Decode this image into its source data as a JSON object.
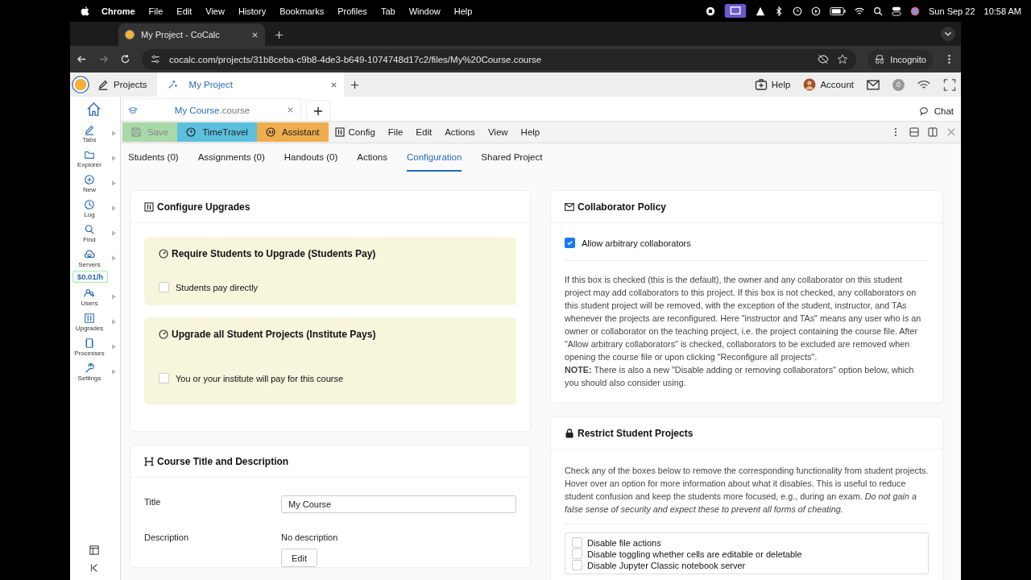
{
  "menubar": {
    "app": "Chrome",
    "items": [
      "File",
      "Edit",
      "View",
      "History",
      "Bookmarks",
      "Profiles",
      "Tab",
      "Window",
      "Help"
    ],
    "date": "Sun Sep 22",
    "time": "10:58 AM"
  },
  "browser": {
    "tab_title": "My Project - CoCalc",
    "url": "cocalc.com/projects/31b8ceba-c9b8-4de3-b649-1074748d17c2/files/My%20Course.course",
    "profile": "Incognito"
  },
  "app_header": {
    "projects": "Projects",
    "project_tab": "My Project",
    "help": "Help",
    "account": "Account",
    "notifications": "0"
  },
  "file_tab": {
    "name": "My Course",
    "ext": ".course",
    "chat": "Chat"
  },
  "toolbar": {
    "buttons": [
      {
        "kind": "save",
        "label": "Save",
        "disabled": true
      },
      {
        "kind": "timetravel",
        "label": "TimeTravel",
        "disabled": false
      },
      {
        "kind": "assistant",
        "label": "Assistant",
        "disabled": false
      }
    ],
    "menus": [
      "Config",
      "File",
      "Edit",
      "Actions",
      "View",
      "Help"
    ]
  },
  "sidebar": {
    "items": [
      {
        "kind": "nav",
        "label": "Tabs"
      },
      {
        "kind": "nav",
        "label": "Explorer"
      },
      {
        "kind": "nav",
        "label": "New"
      },
      {
        "kind": "nav",
        "label": "Log"
      },
      {
        "kind": "nav",
        "label": "Find"
      },
      {
        "kind": "nav",
        "label": "Servers"
      },
      {
        "kind": "cost",
        "label": "$0.01/h"
      },
      {
        "kind": "nav",
        "label": "Users"
      },
      {
        "kind": "nav",
        "label": "Upgrades"
      },
      {
        "kind": "nav",
        "label": "Processes"
      },
      {
        "kind": "nav",
        "label": "Settings"
      }
    ]
  },
  "tabs": [
    {
      "label": "Students (0)",
      "selected": false
    },
    {
      "label": "Assignments (0)",
      "selected": false
    },
    {
      "label": "Handouts (0)",
      "selected": false
    },
    {
      "label": "Actions",
      "selected": false
    },
    {
      "label": "Configuration",
      "selected": true
    },
    {
      "label": "Shared Project",
      "selected": false
    }
  ],
  "configure_upgrades": {
    "title": "Configure Upgrades",
    "panels": [
      {
        "title": "Require Students to Upgrade (Students Pay)",
        "option": {
          "label": "Students pay directly",
          "checked": false
        }
      },
      {
        "title": "Upgrade all Student Projects (Institute Pays)",
        "option": {
          "label": "You or your institute will pay for this course",
          "checked": false
        }
      }
    ]
  },
  "course_title": {
    "title": "Course Title and Description",
    "title_label": "Title",
    "title_value": "My Course",
    "description_label": "Description",
    "description_value": "No description",
    "edit_button": "Edit"
  },
  "collaborator_policy": {
    "title": "Collaborator Policy",
    "option": {
      "label": "Allow arbitrary collaborators",
      "checked": true
    },
    "paragraphs": [
      "If this box is checked (this is the default), the owner and any collaborator on this student project may add collaborators to this project. If this box is not checked, any collaborators on this student project will be removed, with the exception of the student, instructor, and TAs whenever the projects are reconfigured. Here \"instructor and TAs\" means any user who is an owner or collaborator on the teaching project, i.e. the project containing the course file. After \"Allow arbitrary collaborators\" is checked, collaborators to be excluded are removed when opening the course file or upon clicking \"Reconfigure all projects\".",
      "**NOTE:** There is also a new \"Disable adding or removing collaborators\" option below, which you should also consider using."
    ]
  },
  "restrict": {
    "title": "Restrict Student Projects",
    "paragraph": "Check any of the boxes below to remove the corresponding functionality from student projects. Hover over an option for more information about what it disables. This is useful to reduce student confusion and keep the students more focused, e.g., during an exam. *Do not gain a false sense of security and expect these to prevent all forms of cheating.*",
    "options": [
      {
        "label": "Disable file actions",
        "checked": false
      },
      {
        "label": "Disable toggling whether cells are editable or deletable",
        "checked": false
      },
      {
        "label": "Disable Jupyter Classic notebook server",
        "checked": false
      }
    ]
  }
}
